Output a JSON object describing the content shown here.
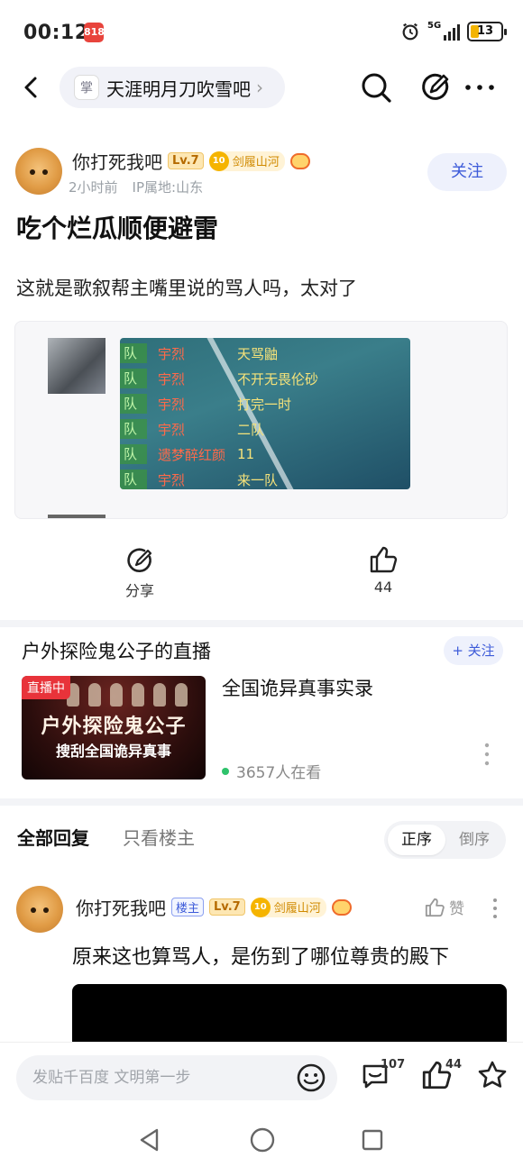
{
  "status_bar": {
    "time": "00:12",
    "app_badge": "818",
    "network": "5G",
    "battery": "13"
  },
  "nav": {
    "forum_name": "天涯明月刀吹雪吧",
    "forum_avatar_glyph": "掌"
  },
  "post": {
    "author": "你打死我吧",
    "level": "Lv.7",
    "rank_num": "10",
    "rank_title": "剑履山河",
    "time": "2小时前",
    "ip": "IP属地:山东",
    "follow_label": "关注",
    "title": "吃个烂瓜顺便避雷",
    "body": "这就是歌叙帮主嘴里说的骂人吗，太对了",
    "image_chat_rows": [
      {
        "tag": "队",
        "name": "宇烈",
        "msg": "天骂鼬"
      },
      {
        "tag": "队",
        "name": "宇烈",
        "msg": "不开无畏伦砂"
      },
      {
        "tag": "队",
        "name": "宇烈",
        "msg": "打完一时"
      },
      {
        "tag": "队",
        "name": "宇烈",
        "msg": "二队"
      },
      {
        "tag": "队",
        "name": "遗梦醉红颜",
        "msg": "11"
      },
      {
        "tag": "队",
        "name": "宇烈",
        "msg": "来一队"
      }
    ]
  },
  "actions": {
    "share_label": "分享",
    "like_count": "44"
  },
  "live": {
    "header": "户外探险鬼公子的直播",
    "follow_label": "+ 关注",
    "badge": "直播中",
    "cover_line1": "户外探险鬼公子",
    "cover_line2": "搜刮全国诡异真事",
    "name": "全国诡异真事实录",
    "viewers": "3657人在看"
  },
  "replies_header": {
    "all_label": "全部回复",
    "op_only_label": "只看楼主",
    "order_positive": "正序",
    "order_reverse": "倒序"
  },
  "reply": {
    "author": "你打死我吧",
    "op_badge": "楼主",
    "level": "Lv.7",
    "rank_num": "10",
    "rank_title": "剑履山河",
    "like_label": "赞",
    "text": "原来这也算骂人，是伤到了哪位尊贵的殿下"
  },
  "bottom_bar": {
    "placeholder": "发贴千百度 文明第一步",
    "comment_count": "107",
    "like_count": "44"
  },
  "colors": {
    "accent": "#3d5bd9",
    "live_red": "#e8333a",
    "live_dot": "#2ec26b"
  }
}
